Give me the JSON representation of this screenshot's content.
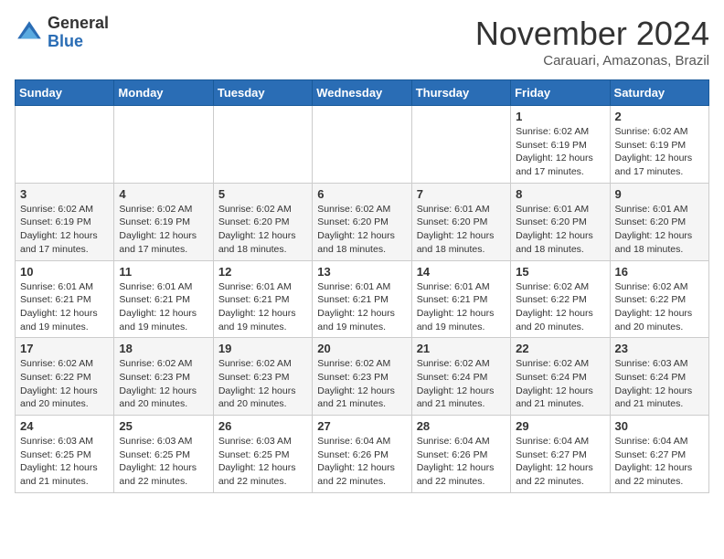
{
  "header": {
    "logo_general": "General",
    "logo_blue": "Blue",
    "month_title": "November 2024",
    "location": "Carauari, Amazonas, Brazil"
  },
  "weekdays": [
    "Sunday",
    "Monday",
    "Tuesday",
    "Wednesday",
    "Thursday",
    "Friday",
    "Saturday"
  ],
  "weeks": [
    [
      {
        "day": "",
        "sunrise": "",
        "sunset": "",
        "daylight": ""
      },
      {
        "day": "",
        "sunrise": "",
        "sunset": "",
        "daylight": ""
      },
      {
        "day": "",
        "sunrise": "",
        "sunset": "",
        "daylight": ""
      },
      {
        "day": "",
        "sunrise": "",
        "sunset": "",
        "daylight": ""
      },
      {
        "day": "",
        "sunrise": "",
        "sunset": "",
        "daylight": ""
      },
      {
        "day": "1",
        "sunrise": "Sunrise: 6:02 AM",
        "sunset": "Sunset: 6:19 PM",
        "daylight": "Daylight: 12 hours and 17 minutes."
      },
      {
        "day": "2",
        "sunrise": "Sunrise: 6:02 AM",
        "sunset": "Sunset: 6:19 PM",
        "daylight": "Daylight: 12 hours and 17 minutes."
      }
    ],
    [
      {
        "day": "3",
        "sunrise": "Sunrise: 6:02 AM",
        "sunset": "Sunset: 6:19 PM",
        "daylight": "Daylight: 12 hours and 17 minutes."
      },
      {
        "day": "4",
        "sunrise": "Sunrise: 6:02 AM",
        "sunset": "Sunset: 6:19 PM",
        "daylight": "Daylight: 12 hours and 17 minutes."
      },
      {
        "day": "5",
        "sunrise": "Sunrise: 6:02 AM",
        "sunset": "Sunset: 6:20 PM",
        "daylight": "Daylight: 12 hours and 18 minutes."
      },
      {
        "day": "6",
        "sunrise": "Sunrise: 6:02 AM",
        "sunset": "Sunset: 6:20 PM",
        "daylight": "Daylight: 12 hours and 18 minutes."
      },
      {
        "day": "7",
        "sunrise": "Sunrise: 6:01 AM",
        "sunset": "Sunset: 6:20 PM",
        "daylight": "Daylight: 12 hours and 18 minutes."
      },
      {
        "day": "8",
        "sunrise": "Sunrise: 6:01 AM",
        "sunset": "Sunset: 6:20 PM",
        "daylight": "Daylight: 12 hours and 18 minutes."
      },
      {
        "day": "9",
        "sunrise": "Sunrise: 6:01 AM",
        "sunset": "Sunset: 6:20 PM",
        "daylight": "Daylight: 12 hours and 18 minutes."
      }
    ],
    [
      {
        "day": "10",
        "sunrise": "Sunrise: 6:01 AM",
        "sunset": "Sunset: 6:21 PM",
        "daylight": "Daylight: 12 hours and 19 minutes."
      },
      {
        "day": "11",
        "sunrise": "Sunrise: 6:01 AM",
        "sunset": "Sunset: 6:21 PM",
        "daylight": "Daylight: 12 hours and 19 minutes."
      },
      {
        "day": "12",
        "sunrise": "Sunrise: 6:01 AM",
        "sunset": "Sunset: 6:21 PM",
        "daylight": "Daylight: 12 hours and 19 minutes."
      },
      {
        "day": "13",
        "sunrise": "Sunrise: 6:01 AM",
        "sunset": "Sunset: 6:21 PM",
        "daylight": "Daylight: 12 hours and 19 minutes."
      },
      {
        "day": "14",
        "sunrise": "Sunrise: 6:01 AM",
        "sunset": "Sunset: 6:21 PM",
        "daylight": "Daylight: 12 hours and 19 minutes."
      },
      {
        "day": "15",
        "sunrise": "Sunrise: 6:02 AM",
        "sunset": "Sunset: 6:22 PM",
        "daylight": "Daylight: 12 hours and 20 minutes."
      },
      {
        "day": "16",
        "sunrise": "Sunrise: 6:02 AM",
        "sunset": "Sunset: 6:22 PM",
        "daylight": "Daylight: 12 hours and 20 minutes."
      }
    ],
    [
      {
        "day": "17",
        "sunrise": "Sunrise: 6:02 AM",
        "sunset": "Sunset: 6:22 PM",
        "daylight": "Daylight: 12 hours and 20 minutes."
      },
      {
        "day": "18",
        "sunrise": "Sunrise: 6:02 AM",
        "sunset": "Sunset: 6:23 PM",
        "daylight": "Daylight: 12 hours and 20 minutes."
      },
      {
        "day": "19",
        "sunrise": "Sunrise: 6:02 AM",
        "sunset": "Sunset: 6:23 PM",
        "daylight": "Daylight: 12 hours and 20 minutes."
      },
      {
        "day": "20",
        "sunrise": "Sunrise: 6:02 AM",
        "sunset": "Sunset: 6:23 PM",
        "daylight": "Daylight: 12 hours and 21 minutes."
      },
      {
        "day": "21",
        "sunrise": "Sunrise: 6:02 AM",
        "sunset": "Sunset: 6:24 PM",
        "daylight": "Daylight: 12 hours and 21 minutes."
      },
      {
        "day": "22",
        "sunrise": "Sunrise: 6:02 AM",
        "sunset": "Sunset: 6:24 PM",
        "daylight": "Daylight: 12 hours and 21 minutes."
      },
      {
        "day": "23",
        "sunrise": "Sunrise: 6:03 AM",
        "sunset": "Sunset: 6:24 PM",
        "daylight": "Daylight: 12 hours and 21 minutes."
      }
    ],
    [
      {
        "day": "24",
        "sunrise": "Sunrise: 6:03 AM",
        "sunset": "Sunset: 6:25 PM",
        "daylight": "Daylight: 12 hours and 21 minutes."
      },
      {
        "day": "25",
        "sunrise": "Sunrise: 6:03 AM",
        "sunset": "Sunset: 6:25 PM",
        "daylight": "Daylight: 12 hours and 22 minutes."
      },
      {
        "day": "26",
        "sunrise": "Sunrise: 6:03 AM",
        "sunset": "Sunset: 6:25 PM",
        "daylight": "Daylight: 12 hours and 22 minutes."
      },
      {
        "day": "27",
        "sunrise": "Sunrise: 6:04 AM",
        "sunset": "Sunset: 6:26 PM",
        "daylight": "Daylight: 12 hours and 22 minutes."
      },
      {
        "day": "28",
        "sunrise": "Sunrise: 6:04 AM",
        "sunset": "Sunset: 6:26 PM",
        "daylight": "Daylight: 12 hours and 22 minutes."
      },
      {
        "day": "29",
        "sunrise": "Sunrise: 6:04 AM",
        "sunset": "Sunset: 6:27 PM",
        "daylight": "Daylight: 12 hours and 22 minutes."
      },
      {
        "day": "30",
        "sunrise": "Sunrise: 6:04 AM",
        "sunset": "Sunset: 6:27 PM",
        "daylight": "Daylight: 12 hours and 22 minutes."
      }
    ]
  ]
}
